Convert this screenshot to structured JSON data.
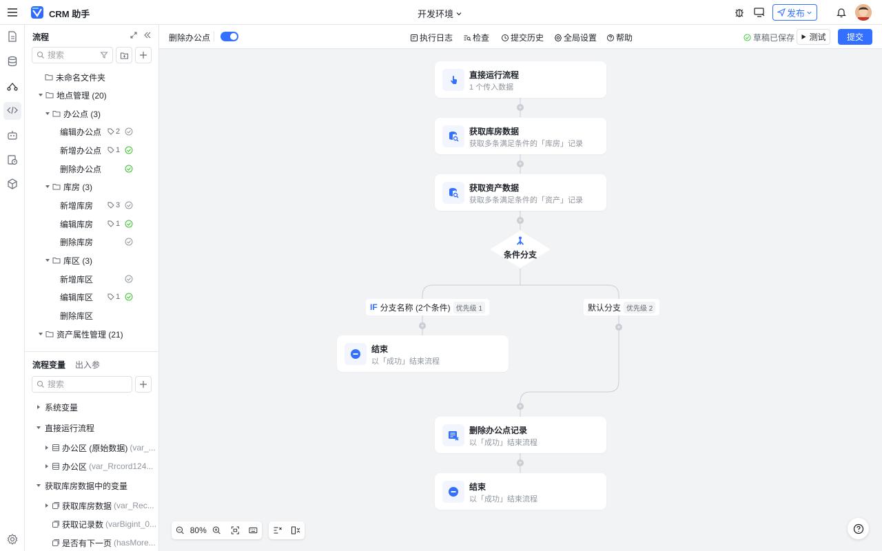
{
  "header": {
    "app_title": "CRM 助手",
    "environment": "开发环境",
    "publish_label": "发布"
  },
  "panel": {
    "title": "流程",
    "search_placeholder": "搜索",
    "tree": [
      {
        "label": "未命名文件夹"
      },
      {
        "label": "地点管理 (20)"
      },
      {
        "label": "办公点 (3)"
      },
      {
        "label": "编辑办公点",
        "tag": "2"
      },
      {
        "label": "新增办公点",
        "tag": "1"
      },
      {
        "label": "删除办公点"
      },
      {
        "label": "库房 (3)"
      },
      {
        "label": "新增库房",
        "tag": "3"
      },
      {
        "label": "编辑库房",
        "tag": "1"
      },
      {
        "label": "删除库房"
      },
      {
        "label": "库区 (3)"
      },
      {
        "label": "新增库区"
      },
      {
        "label": "编辑库区",
        "tag": "1"
      },
      {
        "label": "删除库区"
      },
      {
        "label": "资产属性管理 (21)"
      }
    ]
  },
  "vars": {
    "tab_vars": "流程变量",
    "tab_io": "出入参",
    "search_placeholder": "搜索",
    "rows": [
      {
        "label": "系统变量",
        "sub": ""
      },
      {
        "label": "直接运行流程",
        "sub": ""
      },
      {
        "label": "办公区 (原始数据)",
        "sub": "(var_..."
      },
      {
        "label": "办公区",
        "sub": "(var_Rrcord124..."
      },
      {
        "label": "获取库房数据中的变量",
        "sub": ""
      },
      {
        "label": "获取库房数据",
        "sub": "(var_Rec..."
      },
      {
        "label": "获取记录数",
        "sub": "(varBigint_0..."
      },
      {
        "label": "是否有下一页",
        "sub": "(hasMore..."
      }
    ]
  },
  "toolbar": {
    "flow_name": "删除办公点",
    "exec_log": "执行日志",
    "check": "检查",
    "history": "提交历史",
    "global": "全局设置",
    "help": "帮助",
    "saved": "草稿已保存",
    "test": "测试",
    "submit": "提交"
  },
  "flow": {
    "n1": {
      "title": "直接运行流程",
      "desc": "1 个传入数据"
    },
    "n2": {
      "title": "获取库房数据",
      "desc": "获取多条满足条件的「库房」记录"
    },
    "n3": {
      "title": "获取资产数据",
      "desc": "获取多条满足条件的「资产」记录"
    },
    "cond": "条件分支",
    "branch_if_kw": "IF",
    "branch_if": "分支名称 (2个条件)",
    "branch_if_prio": "优先级 1",
    "branch_default": "默认分支",
    "branch_default_prio": "优先级 2",
    "end1": {
      "title": "结束",
      "desc": "以「成功」结束流程"
    },
    "n4": {
      "title": "删除办公点记录",
      "desc": "以「成功」结束流程"
    },
    "end2": {
      "title": "结束",
      "desc": "以「成功」结束流程"
    }
  },
  "zoom": "80%",
  "colors": {
    "accent": "#3370ff",
    "success": "#34c724",
    "line": "#c9cdd4"
  }
}
